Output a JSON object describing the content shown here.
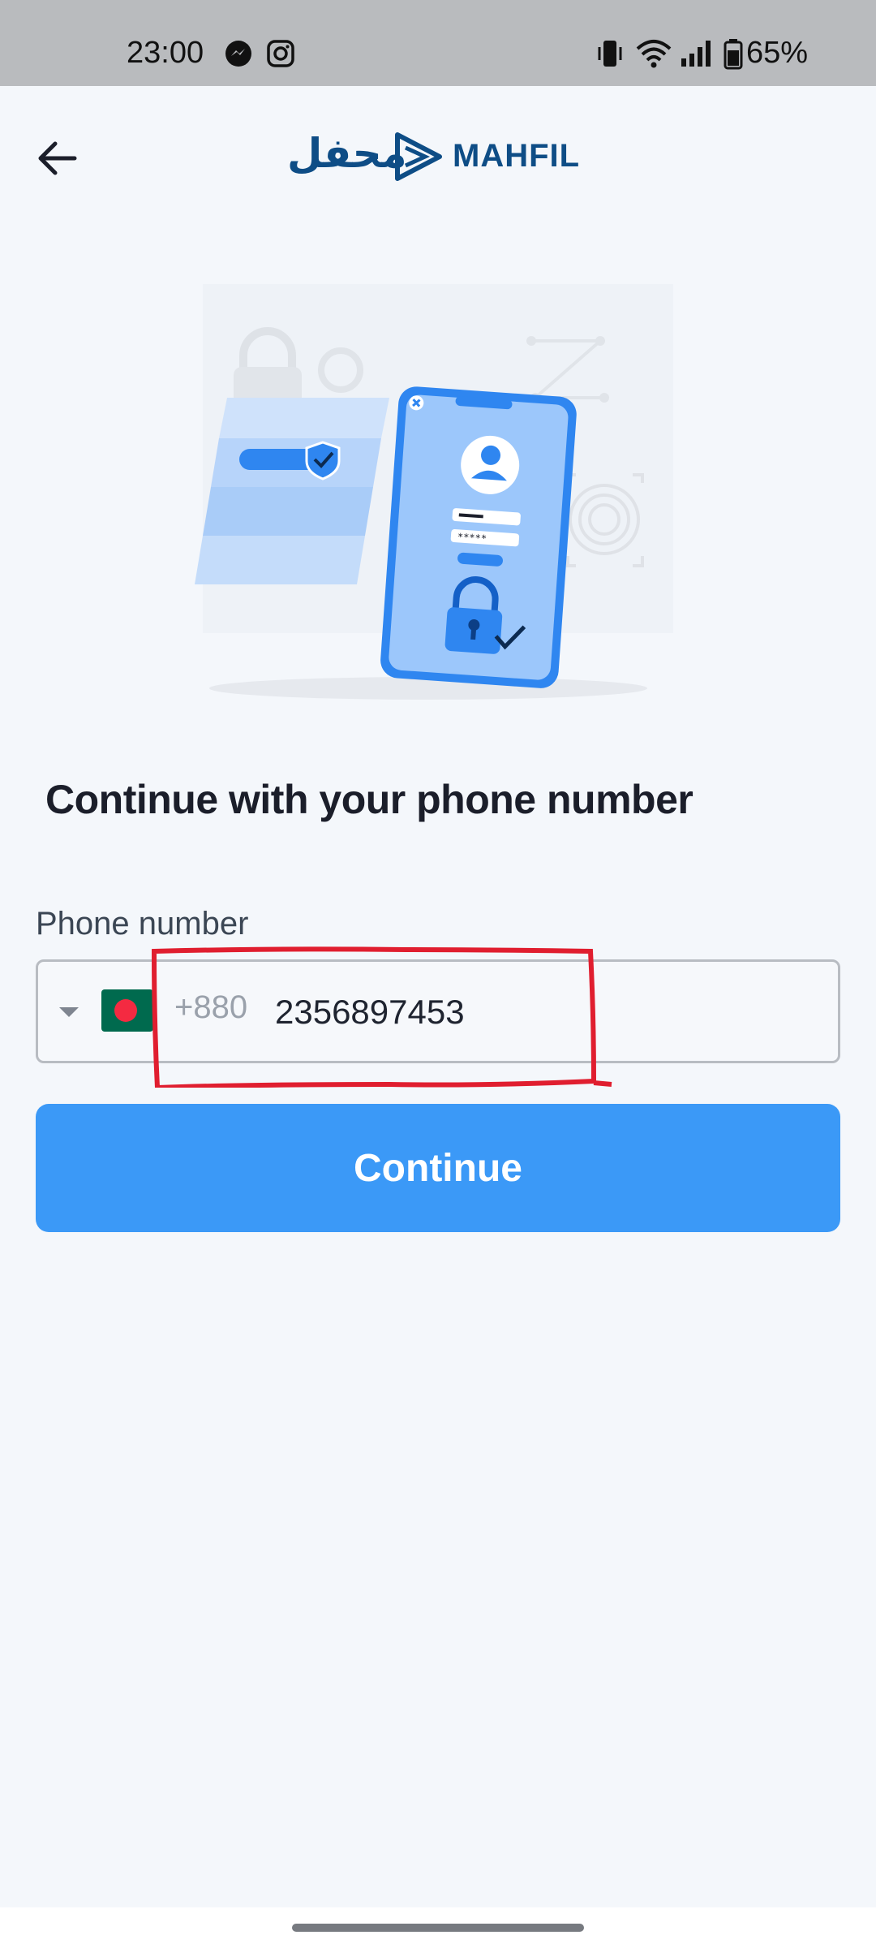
{
  "status_bar": {
    "time": "23:00",
    "battery": "65%",
    "icons": [
      "messenger-icon",
      "instagram-icon",
      "vibrate-icon",
      "wifi-icon",
      "signal-icon",
      "battery-icon"
    ]
  },
  "header": {
    "back_icon": "arrow-left-icon",
    "logo_arabic": "محفل",
    "logo_text": "MAHFIL"
  },
  "hero": {
    "illustration": "phone-security-illustration"
  },
  "main": {
    "title": "Continue with your phone number",
    "phone_label": "Phone number",
    "country_flag": "Bangladesh flag",
    "dial_code": "+880",
    "phone_value": "2356897453",
    "continue_label": "Continue"
  },
  "colors": {
    "accent": "#3b99f7",
    "brand": "#0e4d86",
    "background": "#f4f7fb",
    "annotation": "#e01e2f"
  }
}
